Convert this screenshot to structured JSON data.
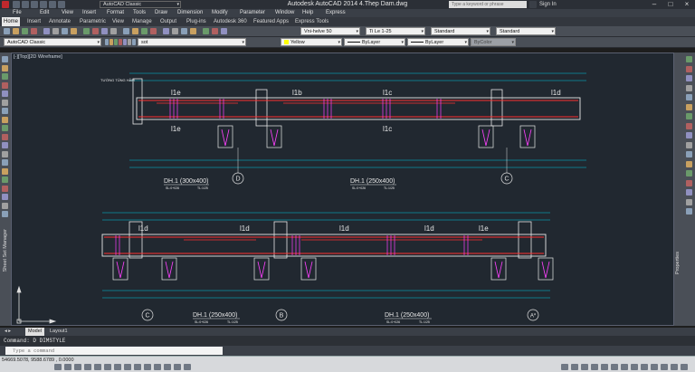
{
  "window": {
    "title": "Autodesk AutoCAD 2014    4.Thep Dam.dwg",
    "workspace": "AutoCAD Classic",
    "search_placeholder": "Type a keyword or phrase",
    "sign_in": "Sign In"
  },
  "menu": [
    "File",
    "Edit",
    "View",
    "Insert",
    "Format",
    "Tools",
    "Draw",
    "Dimension",
    "Modify",
    "Parameter",
    "Window",
    "Help",
    "Express"
  ],
  "ribbon_tabs": [
    {
      "label": "Home",
      "active": true
    },
    {
      "label": "Insert"
    },
    {
      "label": "Annotate"
    },
    {
      "label": "Parametric"
    },
    {
      "label": "View"
    },
    {
      "label": "Manage"
    },
    {
      "label": "Output"
    },
    {
      "label": "Plug-ins"
    },
    {
      "label": "Autodesk 360"
    },
    {
      "label": "Featured Apps"
    },
    {
      "label": "Express Tools"
    }
  ],
  "toolbar": {
    "text_style": "Vni-helve 50",
    "dim_style": "Ti Le 1-25",
    "table_style": "Standard",
    "multileader_style": "Standard",
    "workspace_combo": "AutoCAD Classic",
    "layer": "sot",
    "color": "Yellow",
    "linetype": "ByLayer",
    "lineweight": "ByLayer",
    "plotstyle": "ByColor"
  },
  "viewport_label": "[-][Top][2D Wireframe]",
  "drawing": {
    "top_beam": {
      "title": "DH.1 (300x400)",
      "title2": "DH.1 (250x400)",
      "scale_label": "SL:0+026",
      "tl_label": "TL:1/25",
      "rebars": [
        "l1e",
        "l1b",
        "l1c",
        "l1d",
        "l1e",
        "l1c"
      ],
      "grid_marks": [
        "D",
        "C"
      ],
      "wall_label": "TƯỜNG TỦNG HẦM"
    },
    "bottom_beam": {
      "title": "DH.1 (250x400)",
      "title2": "DH.1 (250x400)",
      "scale_label": "SL:0+026",
      "tl_label": "TL:1/25",
      "rebars": [
        "l1d",
        "l1d",
        "l1d",
        "l1d",
        "l1e"
      ],
      "grid_marks": [
        "C",
        "B",
        "A*"
      ]
    }
  },
  "left_palette_label": "Sheet Set Manager",
  "right_palette_label": "Properties",
  "layout_tabs": [
    {
      "label": "Model",
      "active": true
    },
    {
      "label": "Layout1"
    }
  ],
  "command_history": "Command: D DIMSTYLE",
  "command_prompt": "Type a command",
  "coordinates": "54669.5078, 9588.6789 , 0.0000",
  "colors": {
    "beam": "#e8e8e8",
    "dim": "#00c8e0",
    "rebar": "#ff3030",
    "stirrup": "#ff40ff",
    "grid": "#e0e0e0",
    "section": "#d8d860"
  }
}
